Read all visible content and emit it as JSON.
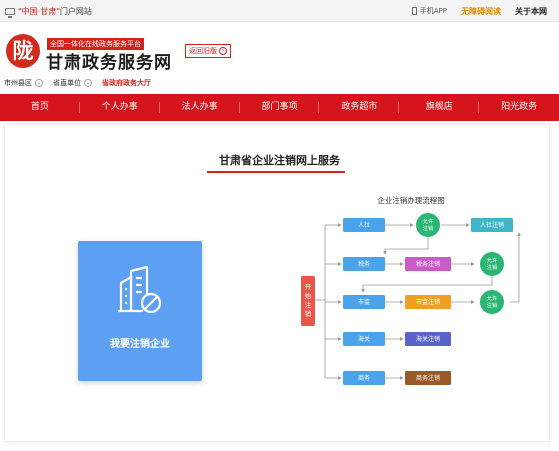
{
  "topbar": {
    "site_quote_1": "\"中国·甘肃\"",
    "site_rest": "门户网站",
    "mobile_app": "手机APP",
    "accessible": "无障碍阅读",
    "about": "关于本网"
  },
  "header": {
    "logo_char": "陇",
    "tag": "全国一体化在线政务服务平台",
    "title": "甘肃政务服务网",
    "return_label": "返回旧版"
  },
  "selectors": {
    "region": "市州县区",
    "dept": "省直单位",
    "hall": "省政府政务大厅"
  },
  "nav": {
    "items": [
      "首页",
      "个人办事",
      "法人办事",
      "部门事项",
      "政务超市",
      "旗舰店",
      "阳光政务"
    ]
  },
  "page": {
    "title": "甘肃省企业注销网上服务",
    "card_label": "我要注销企业"
  },
  "flow": {
    "title": "企业注销办理流程图",
    "start": "开始注销",
    "row1": "人社",
    "row1_result": "允许注销",
    "row1_final": "人社注销",
    "row2": "税务",
    "row2_action": "税务注销",
    "row2_result": "允许注销",
    "row3": "市监",
    "row3_action": "市监注销",
    "row3_result": "允许注销",
    "row4": "海关",
    "row4_action": "海关注销",
    "row5": "商务",
    "row5_action": "商务注销",
    "colors": {
      "start": "#e8574a",
      "dept": "#4aa3ea",
      "allow": "#2bb673",
      "hr_cancel": "#3fb6c8",
      "tax_cancel": "#c85bc8",
      "market_cancel": "#f0a020",
      "customs_cancel": "#5a64c8",
      "commerce_cancel": "#9a5a28"
    }
  }
}
